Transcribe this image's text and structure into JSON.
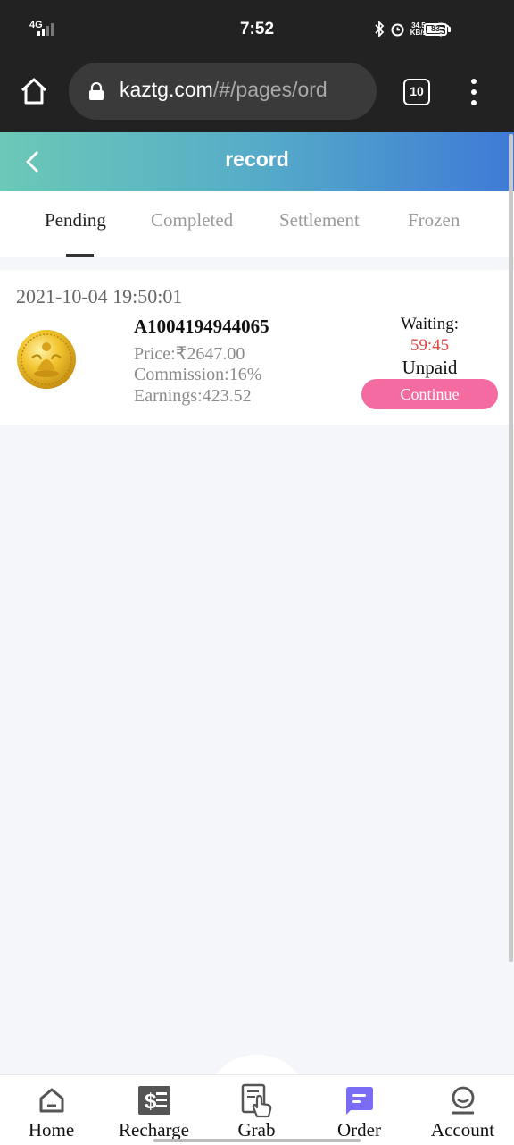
{
  "status_bar": {
    "network": "4G",
    "time": "7:52",
    "speed_value": "34.5",
    "speed_unit": "KB/s",
    "battery": "83",
    "battery_level": 0.83
  },
  "browser": {
    "url_host": "kaztg.com",
    "url_path": "/#/pages/ord",
    "tab_count": "10"
  },
  "header": {
    "title": "record"
  },
  "tabs": [
    {
      "label": "Pending",
      "active": true
    },
    {
      "label": "Completed",
      "active": false
    },
    {
      "label": "Settlement",
      "active": false
    },
    {
      "label": "Frozen",
      "active": false
    }
  ],
  "order": {
    "time": "2021-10-04 19:50:01",
    "id": "A1004194944065",
    "price": "Price:₹2647.00",
    "commission": "Commission:16%",
    "earnings": "Earnings:423.52",
    "waiting_label": "Waiting:",
    "countdown": "59:45",
    "status": "Unpaid",
    "continue_label": "Continue"
  },
  "bottom_nav": [
    {
      "label": "Home",
      "icon": "home-icon"
    },
    {
      "label": "Recharge",
      "icon": "recharge-icon"
    },
    {
      "label": "Grab",
      "icon": "grab-icon"
    },
    {
      "label": "Order",
      "icon": "order-icon"
    },
    {
      "label": "Account",
      "icon": "account-icon"
    }
  ],
  "colors": {
    "header_gradient_start": "#6cc8b7",
    "header_gradient_end": "#3e7ad6",
    "continue_button": "#f36ba0",
    "countdown": "#e04848",
    "order_icon": "#7b6cf6"
  }
}
